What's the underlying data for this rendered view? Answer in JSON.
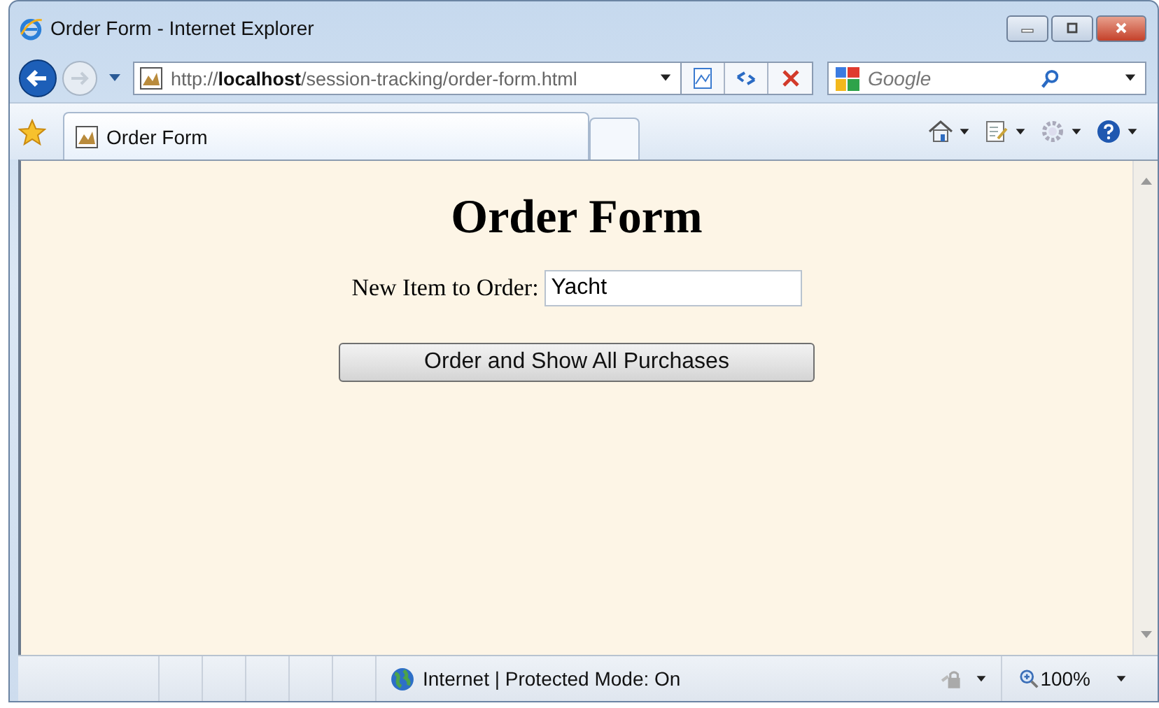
{
  "window": {
    "title": "Order Form - Internet Explorer"
  },
  "address_bar": {
    "url": "http://**localhost**/session-tracking/order-form.html"
  },
  "search": {
    "placeholder": "Google"
  },
  "tabs": [
    {
      "label": "Order Form",
      "selected": true
    }
  ],
  "page": {
    "heading": "Order Form",
    "field_label": "New Item to Order:",
    "field_value": "Yacht",
    "button": "Order and Show All Purchases"
  },
  "status_bar": {
    "zone": "Internet | Protected Mode: On",
    "zoom": "100%"
  }
}
